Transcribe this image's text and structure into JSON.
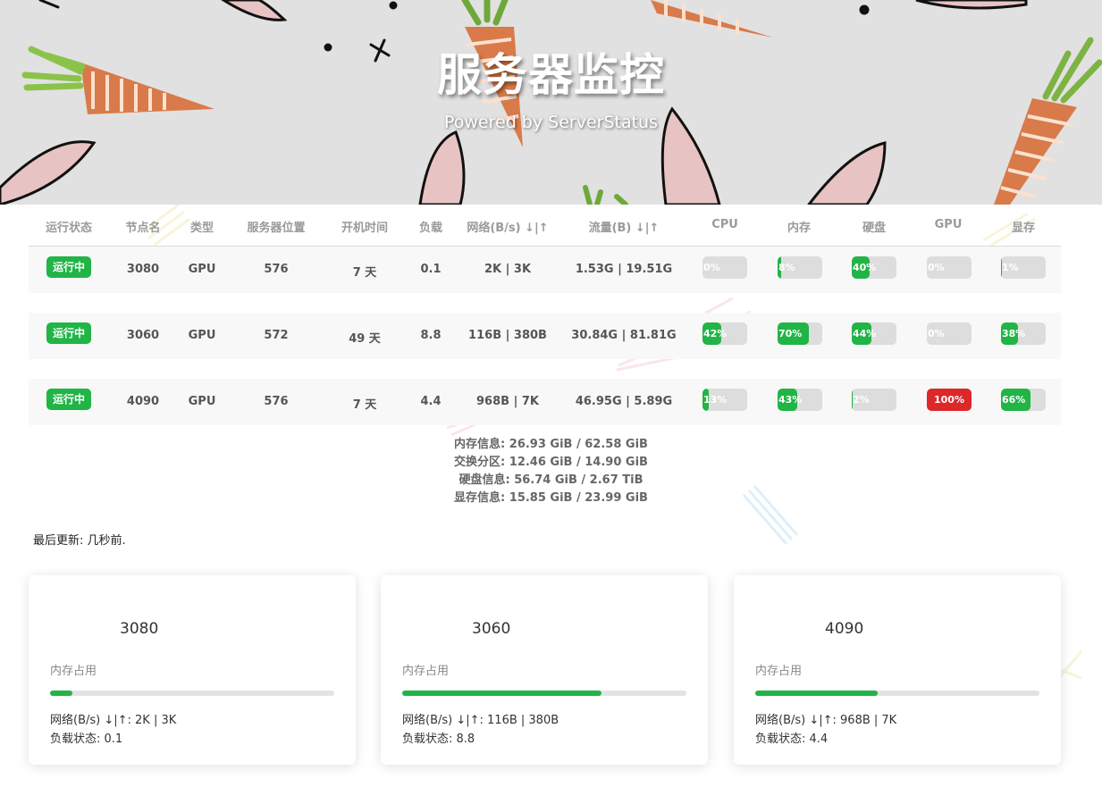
{
  "header": {
    "title": "服务器监控",
    "subtitle": "Powered by ServerStatus"
  },
  "colors": {
    "online": "#21b447",
    "danger": "#dc2828",
    "bar_track": "#dddddd",
    "header_bg": "#e1e1e1"
  },
  "table": {
    "columns": [
      "运行状态",
      "节点名",
      "类型",
      "服务器位置",
      "开机时间",
      "负载",
      "网络(B/s) ↓|↑",
      "流量(B) ↓|↑",
      "CPU",
      "内存",
      "硬盘",
      "GPU",
      "显存"
    ],
    "rows": [
      {
        "status": "运行中",
        "name": "3080",
        "type": "GPU",
        "location": "576",
        "uptime": "7 天",
        "load": "0.1",
        "network": "2K | 3K",
        "traffic": "1.53G | 19.51G",
        "cpu": {
          "text": "0%",
          "value": 0
        },
        "mem": {
          "text": "8%",
          "value": 8
        },
        "disk": {
          "text": "40%",
          "value": 40
        },
        "gpu": {
          "text": "0%",
          "value": 0
        },
        "vram": {
          "text": "1%",
          "value": 1
        }
      },
      {
        "status": "运行中",
        "name": "3060",
        "type": "GPU",
        "location": "572",
        "uptime": "49 天",
        "load": "8.8",
        "network": "116B | 380B",
        "traffic": "30.84G | 81.81G",
        "cpu": {
          "text": "42%",
          "value": 42
        },
        "mem": {
          "text": "70%",
          "value": 70
        },
        "disk": {
          "text": "44%",
          "value": 44
        },
        "gpu": {
          "text": "0%",
          "value": 0
        },
        "vram": {
          "text": "38%",
          "value": 38
        }
      },
      {
        "status": "运行中",
        "name": "4090",
        "type": "GPU",
        "location": "576",
        "uptime": "7 天",
        "load": "4.4",
        "network": "968B | 7K",
        "traffic": "46.95G | 5.89G",
        "cpu": {
          "text": "13%",
          "value": 13
        },
        "mem": {
          "text": "43%",
          "value": 43
        },
        "disk": {
          "text": "2%",
          "value": 2
        },
        "gpu": {
          "text": "100%",
          "value": 100
        },
        "vram": {
          "text": "66%",
          "value": 66
        }
      }
    ]
  },
  "details": {
    "memory": "内存信息: 26.93 GiB / 62.58 GiB",
    "swap": "交换分区: 12.46 GiB / 14.90 GiB",
    "disk": "硬盘信息: 56.74 GiB / 2.67 TiB",
    "vram": "显存信息: 15.85 GiB / 23.99 GiB"
  },
  "last_update": "最后更新: 几秒前.",
  "cards": [
    {
      "name": "3080",
      "label": "内存占用",
      "mem_value": 8,
      "network": "网络(B/s) ↓|↑: 2K | 3K",
      "load": "负载状态: 0.1"
    },
    {
      "name": "3060",
      "label": "内存占用",
      "mem_value": 70,
      "network": "网络(B/s) ↓|↑: 116B | 380B",
      "load": "负载状态: 8.8"
    },
    {
      "name": "4090",
      "label": "内存占用",
      "mem_value": 43,
      "network": "网络(B/s) ↓|↑: 968B | 7K",
      "load": "负载状态: 4.4"
    }
  ]
}
